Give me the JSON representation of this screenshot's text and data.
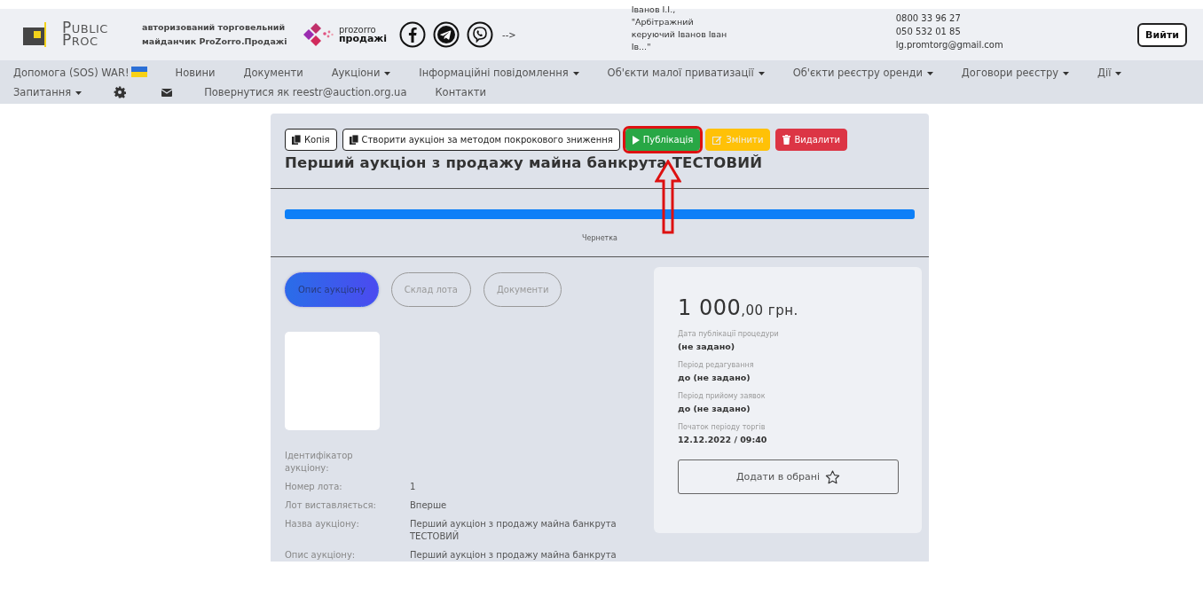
{
  "header": {
    "logo": {
      "line1": "PUBLIC",
      "line2": "PROC"
    },
    "tagline": "авторизований торговельний майданчик ProZorro.Продажі",
    "partner_logo": {
      "line1": "prozorro",
      "line2": "продажі"
    },
    "arrow_text": "-->",
    "user": "Іванов І.І., \"Арбітражний керуючий Іванов Іван Ів...\"",
    "contacts": [
      "0800 33 96 27",
      "050 532 01 85",
      "lg.promtorg@gmail.com"
    ],
    "logout": "Вийти"
  },
  "nav": [
    {
      "kind": "link",
      "label": "Допомога (SOS) WAR!",
      "flag": true
    },
    {
      "kind": "link",
      "label": "Новини"
    },
    {
      "kind": "link",
      "label": "Документи"
    },
    {
      "kind": "dropdown",
      "label": "Аукціони"
    },
    {
      "kind": "dropdown",
      "label": "Інформаційні повідомлення"
    },
    {
      "kind": "dropdown",
      "label": "Об'єкти малої приватизації"
    },
    {
      "kind": "dropdown",
      "label": "Об'єкти реєстру оренди"
    },
    {
      "kind": "dropdown",
      "label": "Договори реєстру"
    },
    {
      "kind": "dropdown",
      "label": "Дії"
    },
    {
      "kind": "dropdown",
      "label": "Запитання"
    },
    {
      "kind": "gear"
    },
    {
      "kind": "mail"
    },
    {
      "kind": "link",
      "label": "Повернутися як reestr@auction.org.ua"
    },
    {
      "kind": "link",
      "label": "Контакти"
    }
  ],
  "actions": [
    {
      "kind": "copy",
      "label": "Копія",
      "highlighted": false
    },
    {
      "kind": "copy",
      "label": "Створити аукціон за методом покрокового зниження",
      "highlighted": false
    },
    {
      "kind": "publish",
      "label": "Публікація",
      "highlighted": true
    },
    {
      "kind": "edit",
      "label": "Змінити",
      "highlighted": false
    },
    {
      "kind": "delete",
      "label": "Видалити",
      "highlighted": false
    }
  ],
  "title": "Перший аукціон з продажу майна банкрута ТЕСТОВИЙ",
  "status": {
    "level": 1,
    "label": "Чернетка"
  },
  "tabs": [
    {
      "label": "Опис аукціону",
      "selected": true
    },
    {
      "label": "Склад лота",
      "selected": false
    },
    {
      "label": "Документи",
      "selected": false
    }
  ],
  "fields": [
    {
      "label": "Ідентифікатор аукціону:"
    },
    {
      "label": "Номер лота:",
      "value": "1"
    },
    {
      "label": "Лот виставляється:",
      "value": "Вперше"
    },
    {
      "label": "Назва аукціону:",
      "value": "Перший аукціон з продажу майна банкрута ТЕСТОВИЙ"
    },
    {
      "label": "Опис аукціону:",
      "value": "Перший аукціон з продажу майна банкрута"
    }
  ],
  "price": {
    "amount": "1 000",
    "fraction": ",00 грн."
  },
  "dates": [
    {
      "label": "Дата публікації процедури",
      "value": "(не задано)"
    },
    {
      "label": "Період редагування",
      "value": "до (не задано)"
    },
    {
      "label": "Період прийому заявок",
      "value": "до (не задано)"
    },
    {
      "label": "Початок періоду торгів",
      "value": "12.12.2022 / 09:40"
    }
  ],
  "favorite": {
    "label": "Додати в обрані"
  }
}
